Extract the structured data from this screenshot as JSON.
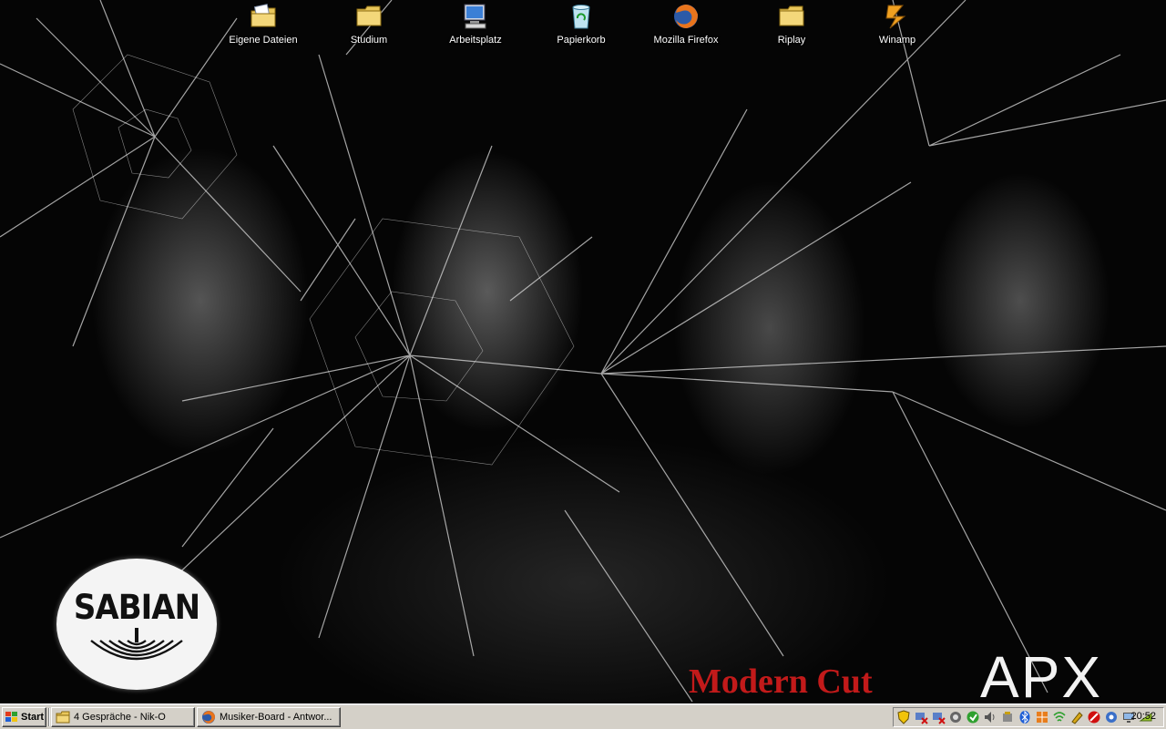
{
  "desktop": {
    "icons": [
      {
        "label": "Eigene Dateien",
        "icon": "my-documents-icon"
      },
      {
        "label": "Studium",
        "icon": "folder-icon"
      },
      {
        "label": "Arbeitsplatz",
        "icon": "my-computer-icon"
      },
      {
        "label": "Papierkorb",
        "icon": "recycle-bin-icon"
      },
      {
        "label": "Mozilla Firefox",
        "icon": "firefox-icon"
      },
      {
        "label": "Riplay",
        "icon": "folder-icon"
      },
      {
        "label": "Winamp",
        "icon": "winamp-icon"
      }
    ]
  },
  "wallpaper": {
    "logo_text": "SABIAN",
    "brand_modern": "Modern Cut",
    "brand_apx": "APX",
    "colors": {
      "modern_cut": "#c21a1a",
      "background": "#050505"
    }
  },
  "taskbar": {
    "start_label": "Start",
    "tasks": [
      {
        "label": "4 Gespräche - Nik-O",
        "icon": "folder-chat-icon"
      },
      {
        "label": "Musiker-Board - Antwor...",
        "icon": "firefox-icon"
      }
    ],
    "tray_icons": [
      "shield-icon",
      "network-x-icon",
      "network-x2-icon",
      "antivirus-icon",
      "app-green-icon",
      "volume-icon",
      "usb-icon",
      "bluetooth-icon",
      "grid-app-icon",
      "wifi-icon",
      "pen-icon",
      "no-entry-icon",
      "gear-icon",
      "monitor-icon",
      "battery-icon"
    ],
    "clock": "20:52"
  }
}
